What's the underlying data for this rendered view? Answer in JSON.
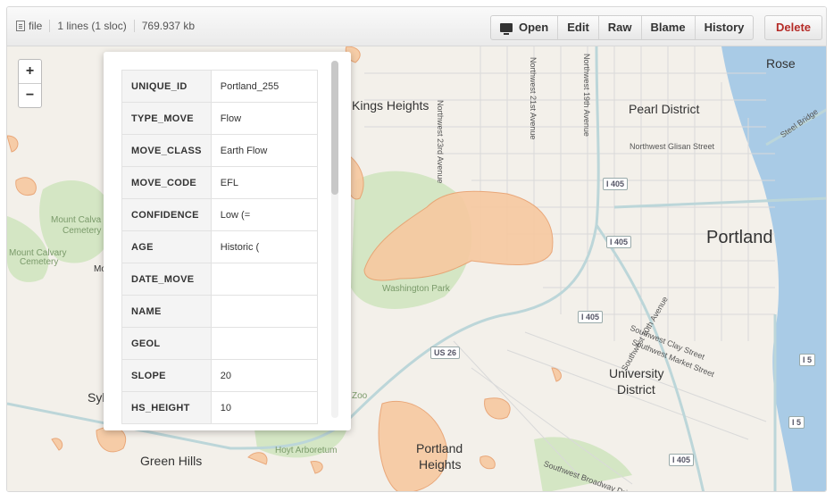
{
  "toolbar": {
    "file_label": "file",
    "lines_label": "1 lines (1 sloc)",
    "size_label": "769.937 kb",
    "buttons": {
      "open": "Open",
      "edit": "Edit",
      "raw": "Raw",
      "blame": "Blame",
      "history": "History"
    },
    "delete_label": "Delete"
  },
  "map": {
    "zoom_in": "+",
    "zoom_out": "−",
    "labels": {
      "kings_heights": "Kings Heights",
      "pearl_district": "Pearl District",
      "portland": "Portland",
      "washington_park": "Washington Park",
      "university_district_1": "University",
      "university_district_2": "District",
      "portland_heights_1": "Portland",
      "portland_heights_2": "Heights",
      "green_hills": "Green Hills",
      "hoyt_arboretum": "Hoyt Arboretum",
      "mount_calvary_1a": "Mount Calva",
      "mount_calvary_1b": "Cemetery",
      "mount_calvary_2a": "Mount Calvary",
      "mount_calvary_2b": "Cemetery",
      "rose": "Rose",
      "zoo": "Zoo",
      "syl": "Syl",
      "mo": "Mo",
      "nw_glisan": "Northwest Glisan Street",
      "nw_23rd": "Northwest 23rd Avenue",
      "nw_21st": "Northwest 21st Avenue",
      "nw_19th": "Northwest 19th Avenue",
      "sw_10th": "Southwest 10th Avenue",
      "sw_clay": "Southwest Clay Street",
      "sw_market": "Southwest Market Street",
      "sw_broadway": "Southwest Broadway Drive",
      "steel_bridge": "Steel Bridge"
    },
    "shields": {
      "i405_a": "I 405",
      "i405_b": "I 405",
      "i405_c": "I 405",
      "i405_d": "I 405",
      "us26": "US 26",
      "i5_a": "I 5",
      "i5_b": "I 5"
    },
    "colors": {
      "water": "#a9cbe6",
      "landslide": "#f7c9a0",
      "park": "#d4e6c4",
      "land": "#f3f0ea"
    }
  },
  "popup": {
    "rows": [
      {
        "key": "UNIQUE_ID",
        "value": "Portland_255"
      },
      {
        "key": "TYPE_MOVE",
        "value": "Flow"
      },
      {
        "key": "MOVE_CLASS",
        "value": "Earth Flow"
      },
      {
        "key": "MOVE_CODE",
        "value": "EFL"
      },
      {
        "key": "CONFIDENCE",
        "value": "Low (="
      },
      {
        "key": "AGE",
        "value": "Historic ("
      },
      {
        "key": "DATE_MOVE",
        "value": ""
      },
      {
        "key": "NAME",
        "value": ""
      },
      {
        "key": "GEOL",
        "value": ""
      },
      {
        "key": "SLOPE",
        "value": "20"
      },
      {
        "key": "HS_HEIGHT",
        "value": "10"
      }
    ]
  }
}
